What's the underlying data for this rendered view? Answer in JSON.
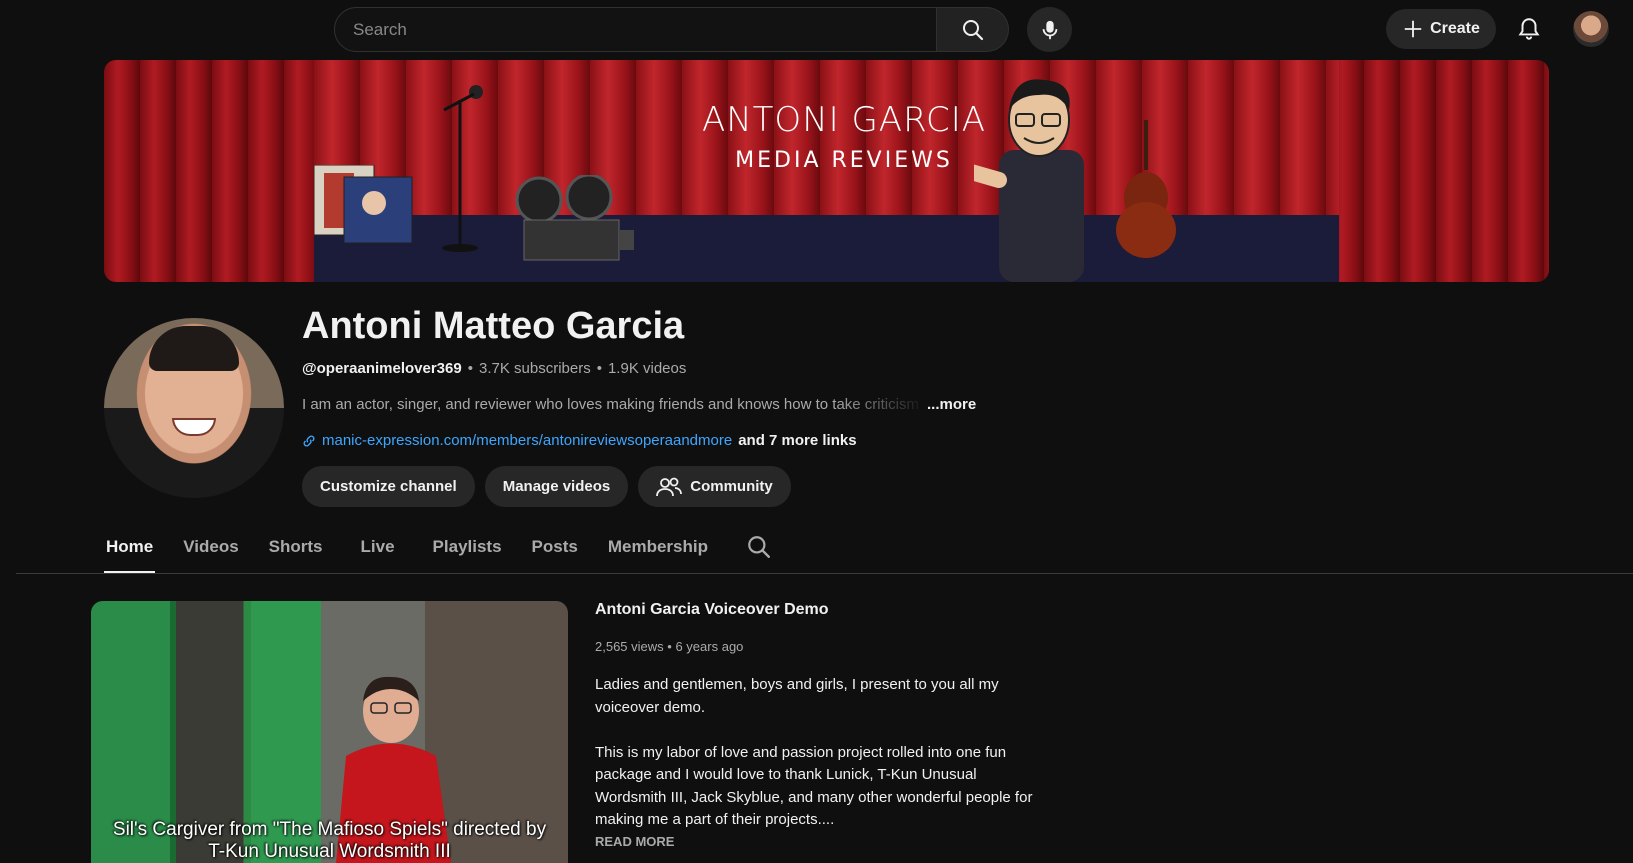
{
  "header": {
    "search_placeholder": "Search",
    "create_label": "Create",
    "icons": [
      "search-icon",
      "microphone-icon",
      "plus-icon",
      "bell-icon"
    ]
  },
  "banner": {
    "title": "ANTONI GARCIA",
    "subtitle": "MEDIA REVIEWS"
  },
  "channel": {
    "name": "Antoni Matteo Garcia",
    "handle": "@operaanimelover369",
    "subscribers": "3.7K subscribers",
    "videos": "1.9K videos",
    "separator": "•",
    "description": "I am an actor, singer, and reviewer who loves making friends and knows how to take criticism",
    "more_label": "...more",
    "link_url": "manic-expression.com/members/antonireviewsoperaandmore",
    "more_links": "and 7 more links",
    "buttons": {
      "customize": "Customize channel",
      "manage": "Manage videos",
      "community": "Community"
    }
  },
  "tabs": [
    {
      "label": "Home",
      "active": true
    },
    {
      "label": "Videos"
    },
    {
      "label": "Shorts"
    },
    {
      "label": "Live"
    },
    {
      "label": "Playlists"
    },
    {
      "label": "Posts"
    },
    {
      "label": "Membership"
    }
  ],
  "featured_video": {
    "thumbnail_caption_line1": "Sil's Cargiver from \"The Mafioso Spiels\" directed by",
    "thumbnail_caption_line2": "T-Kun Unusual Wordsmith III",
    "title": "Antoni Garcia Voiceover Demo",
    "views": "2,565 views",
    "age": "6 years ago",
    "description": "Ladies and gentlemen, boys and girls, I present to you all my voiceover demo.\n\nThis is my labor of love and passion project rolled into one fun package and I would love to thank Lunick, T-Kun Unusual Wordsmith III, Jack Skyblue, and many other wonderful people for making me a part of their projects....",
    "read_more": "READ MORE"
  },
  "colors": {
    "background": "#0f0f0f",
    "link": "#3ea6ff",
    "pill": "#272727"
  }
}
